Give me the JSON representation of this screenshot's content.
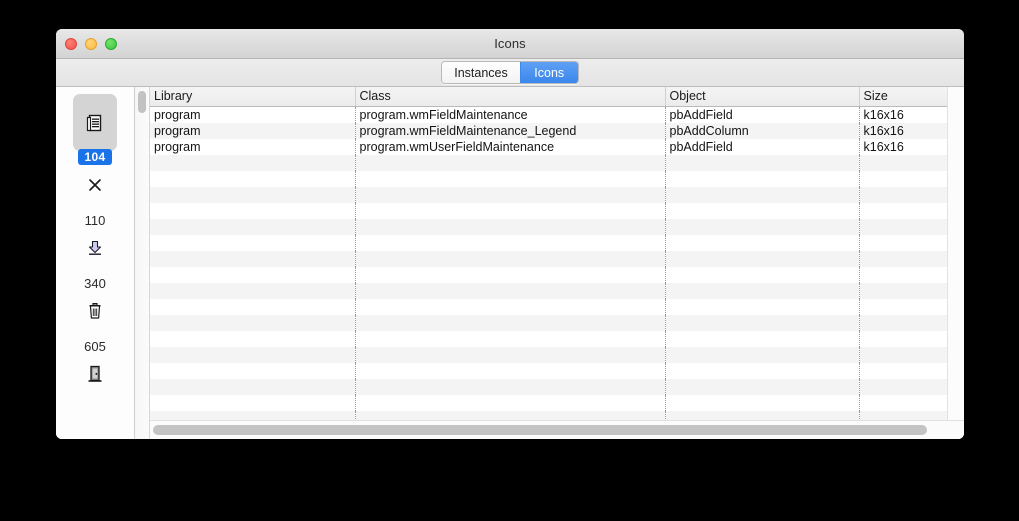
{
  "window": {
    "title": "Icons",
    "traffic_lights": [
      "close-button",
      "minimize-button",
      "zoom-button"
    ]
  },
  "tabs": [
    {
      "label": "Instances",
      "selected": false
    },
    {
      "label": "Icons",
      "selected": true
    }
  ],
  "sidebar": {
    "items": [
      {
        "icon": "document-list-icon",
        "badge": "104",
        "selected": true
      },
      {
        "icon": "close-x-icon",
        "count": "110",
        "selected": false
      },
      {
        "icon": "download-arrow-icon",
        "count": "340",
        "selected": false
      },
      {
        "icon": "trash-icon",
        "count": "605",
        "selected": false
      },
      {
        "icon": "door-exit-icon",
        "count": "",
        "selected": false
      }
    ]
  },
  "table": {
    "columns": [
      "Library",
      "Class",
      "Object",
      "Size"
    ],
    "rows": [
      [
        "program",
        "program.wmFieldMaintenance",
        "pbAddField",
        "k16x16"
      ],
      [
        "program",
        "program.wmFieldMaintenance_Legend",
        "pbAddColumn",
        "k16x16"
      ],
      [
        "program",
        "program.wmUserFieldMaintenance",
        "pbAddField",
        "k16x16"
      ]
    ],
    "empty_row_count": 17
  },
  "colors": {
    "accent_blue": "#1a73e8",
    "tab_selected": "#3b87ec",
    "row_alt": "#f4f4f4",
    "header_bg": "#ececec"
  }
}
